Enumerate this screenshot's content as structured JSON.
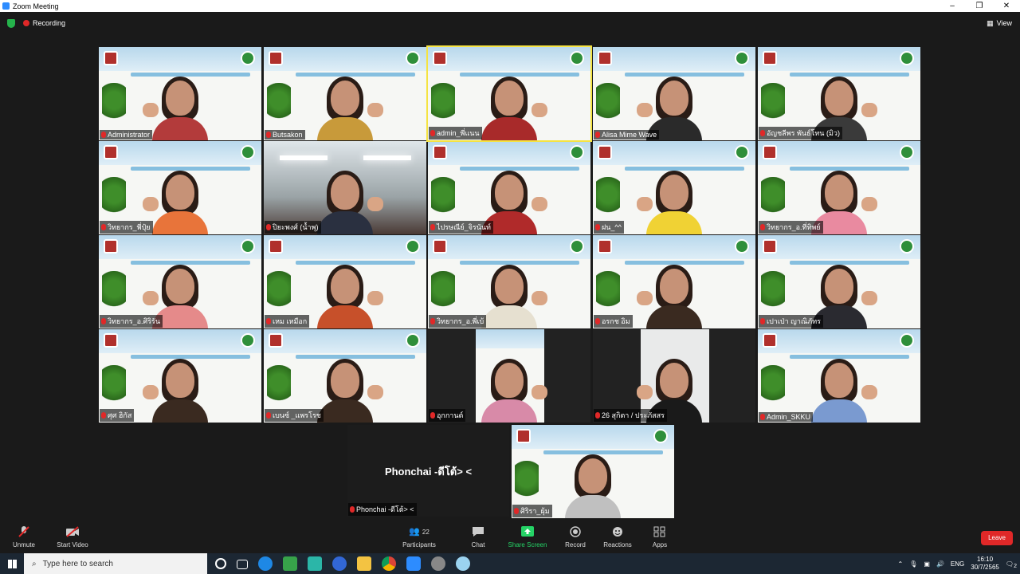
{
  "window": {
    "title": "Zoom Meeting"
  },
  "topbar": {
    "recording_label": "Recording",
    "view_label": "View"
  },
  "participants": [
    {
      "name": "Administrator"
    },
    {
      "name": "Butsakon"
    },
    {
      "name": "admin_พี่แนน"
    },
    {
      "name": "Alisa Mime Wave"
    },
    {
      "name": "อัญชลีพร พันธ์โทน (มิว)"
    },
    {
      "name": "วิทยากร_พี่ปุ๋ย"
    },
    {
      "name": "ปิยะพงศ์ (น้ำพุ)"
    },
    {
      "name": "ไปรษณีย์_จิรนันท์"
    },
    {
      "name": "ฝน_^^"
    },
    {
      "name": "วิทยากร_อ.ที่ทิพย์"
    },
    {
      "name": "วิทยากร_อ.ศิริรัน"
    },
    {
      "name": "เหม เหมือก"
    },
    {
      "name": "วิทยากร_อ.พี่เบ้"
    },
    {
      "name": "อรกช อิม"
    },
    {
      "name": "เปาเป่า ญาณิภัทร"
    },
    {
      "name": "ศุศ ฮิกัส"
    },
    {
      "name": "เบนซ์ _แพรโรช"
    },
    {
      "name": "อุกกานต์"
    },
    {
      "name": "26 สุกิตา / ประภัสสร"
    },
    {
      "name": "Admin_SKKU"
    },
    {
      "name": "Phonchai -ดีโต้> <"
    },
    {
      "name": "ศิริรา_ผุ้ม"
    }
  ],
  "big_name_display": "Phonchai  -ดีโต้> <",
  "toolbar": {
    "unmute": "Unmute",
    "start_video": "Start Video",
    "participants": "Participants",
    "participants_count": "22",
    "chat": "Chat",
    "share_screen": "Share Screen",
    "record": "Record",
    "reactions": "Reactions",
    "apps": "Apps",
    "leave": "Leave"
  },
  "taskbar": {
    "search_placeholder": "Type here to search",
    "language": "ENG",
    "time": "16:10",
    "date": "30/7/2565",
    "notification_count": "2"
  },
  "colors": {
    "accent": "#2d8cff",
    "leave": "#e02828",
    "share": "#25d366",
    "active_speaker": "#f5e342"
  }
}
